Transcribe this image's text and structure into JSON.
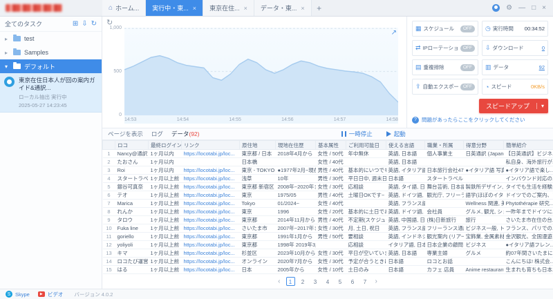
{
  "topbar": {
    "tabs": [
      {
        "label": "ホーム...",
        "icon": "⌂"
      },
      {
        "label": "実行中・東...",
        "close": "×",
        "cls": "active"
      },
      {
        "label": "東京在住...",
        "close": "×"
      },
      {
        "label": "データ・東...",
        "close": "×"
      }
    ],
    "new_tab": "+",
    "window_icons": {
      "gear": "⚙",
      "minimize": "—",
      "maximize": "□",
      "close": "×"
    }
  },
  "sidebar": {
    "title": "全てのタスク",
    "toolbar": [
      {
        "name": "new-task-icon",
        "glyph": "⊞"
      },
      {
        "name": "import-task-icon",
        "glyph": "⇩"
      },
      {
        "name": "refresh-tasks-icon",
        "glyph": "↻"
      }
    ],
    "tree": [
      {
        "arrow": "▸",
        "label": "test"
      },
      {
        "arrow": "▸",
        "label": "Samples"
      },
      {
        "arrow": "▾",
        "label": "デフォルト",
        "cls": "selected"
      }
    ],
    "task": {
      "title": "東京在住日本人が回の案内ガイド&通訳...",
      "line1": "ローカル抽出 実行中",
      "line2": "2025-05-27 14:23:45"
    }
  },
  "main_icons": {
    "refresh": "↻",
    "expand": "↗"
  },
  "chart_data": {
    "type": "area",
    "title": "",
    "ylim": [
      0,
      1000
    ],
    "y_max": 1000,
    "y_ticks": [
      "1,000",
      "500",
      "0"
    ],
    "x_ticks": [
      "14:53",
      "14:54",
      "14:55",
      "14:56",
      "14:57",
      "14:58"
    ],
    "values": [
      520,
      560,
      610,
      660,
      680,
      650,
      600,
      570,
      555,
      540,
      430,
      400,
      470,
      580,
      640,
      600,
      520,
      480,
      520,
      580,
      620,
      600,
      560,
      535,
      520,
      505,
      495,
      480,
      440,
      380,
      250,
      150
    ]
  },
  "stats": {
    "boxes": [
      {
        "name": "calendar-icon",
        "glyph": "▦",
        "label": "スケジュール",
        "badge": "OFF"
      },
      {
        "name": "clock-icon",
        "glyph": "◷",
        "label": "実行時間",
        "value": "00:34:52",
        "vcls": "v-dark"
      },
      {
        "name": "ip-rotation-icon",
        "glyph": "⇄",
        "label": "IPローテーション",
        "badge": "OFF"
      },
      {
        "name": "download-icon",
        "glyph": "⇩",
        "label": "ダウンロード",
        "value": "0",
        "vcls": "v-link"
      },
      {
        "name": "dedup-icon",
        "glyph": "▤",
        "label": "重複排除",
        "badge": "OFF"
      },
      {
        "name": "database-icon",
        "glyph": "▥",
        "label": "データ",
        "value": "92",
        "vcls": "v-link"
      },
      {
        "name": "export-icon",
        "glyph": "⇪",
        "label": "自動エクスポート",
        "badge": "OFF"
      },
      {
        "name": "speed-icon",
        "glyph": "◔",
        "label": "スピード",
        "value": "0KB/s",
        "vcls": "v-orange"
      }
    ],
    "speedup_label": "スピードアップ",
    "speedup_caret": "▾",
    "help_icon": "?",
    "help_text": "問題があったらここをクリックしてください"
  },
  "controls": {
    "tabs": [
      {
        "label": "ページを表示"
      },
      {
        "label": "ログ"
      },
      {
        "label": "データ",
        "count": "(92)",
        "cls": "active"
      }
    ],
    "pause_label": "一時停止",
    "run_label": "起動"
  },
  "table": {
    "columns": [
      "ロコ",
      "最終ログイン",
      "リンク",
      "原住地",
      "現地在住歴",
      "基本属性",
      "ご利用可能日",
      "使える言語",
      "職業・所属",
      "得意分野",
      "簡単紹介"
    ],
    "rows": [
      [
        "Nancy@通訳",
        "1ヶ月以内",
        "https://locotabi.jp/loc...",
        "東京都 / 日本",
        "2018年4月から",
        "女性 / 50代",
        "年中無休",
        "英語, 日本語",
        "個人事業主",
        "日英通訳 (Japanese...",
        "【日英通訳】ビジネ..."
      ],
      [
        "たおさん",
        "1ヶ月以内",
        "",
        "日本橋",
        "",
        "女性 / 40代",
        "",
        "英語, 日本語",
        "",
        "",
        "私自身、海外旅行が..."
      ],
      [
        "Roi",
        "1ヶ月以内",
        "https://locotabi.jp/loc...",
        "東京 - TOKYO",
        "●1977年2月~現在...",
        "男性 / 40代",
        "基本的にいつでも可",
        "英語, イタリア語, 日...",
        "日本旅行会社47年勤...",
        "●イタリア語 写真...",
        "●イタリア語で楽し..."
      ],
      [
        "スタートラベル",
        "1ヶ月以上前",
        "https://locotabi.jp/loc...",
        "浅草",
        "10年",
        "男性 / 30代",
        "平日日中, 週末日中",
        "日本語",
        "スタートラベル",
        "",
        "インバウンド対応の..."
      ],
      [
        "銀谷可真奈",
        "1ヶ月以上前",
        "https://locotabi.jp/loc...",
        "東京都 新宿区",
        "2008年~2020年ま...",
        "女性 / 30代",
        "応相談",
        "英語, タイ語, 日本語",
        "舞台芸術, 日本語教...",
        "製鉄所デザイン, 縫...",
        "タイでも生活を経験..."
      ],
      [
        "テオ",
        "1ヶ月以上前",
        "https://locotabi.jp/loc...",
        "東京",
        "1975/05",
        "男性 / 40代",
        "土曜日OKです~",
        "英語, ドイツ語, フラ...",
        "観光庁, フリーラン...",
        "語学(ほぼのイタリア...",
        "ドイツでのご案内、ア..."
      ],
      [
        "Marica",
        "1ヶ月以上前",
        "https://locotabi.jp/loc...",
        "Tokyo",
        "01/2024~",
        "女性 / 40代",
        "",
        "英語, フランス語, 日...",
        "",
        "Wellness 関連, 美...",
        "Phytothérapie 研究..."
      ],
      [
        "れんか",
        "1ヶ月以上前",
        "https://locotabi.jp/loc...",
        "東京",
        "1996",
        "女性 / 20代",
        "基本的に土日であれ...",
        "英語, ドイツ語, 日本語",
        "会社員",
        "グルメ, 観光, ショッ...",
        "一昨年までドイツに..."
      ],
      [
        "タロウ",
        "1ヶ月以上前",
        "https://locotabi.jp/loc...",
        "東京都",
        "2014年11月から",
        "男性 / 40代",
        "不定期(スケジュール...",
        "英語, 中国語, 日本語",
        "(株)日新旅行",
        "旅行",
        "さいたま市在住の台..."
      ],
      [
        "Fuka line",
        "1ヶ月以上前",
        "https://locotabi.jp/loc...",
        "さいたま市",
        "2007年~2017年ま...",
        "女性 / 30代",
        "月, 土日, 祝日",
        "英語, フランス語, 日...",
        "フリーランス通訳翻...",
        "ビジネス一般, トラベ...",
        "フランス、パリでの..."
      ],
      [
        "goriello",
        "1ヶ月以上前",
        "https://locotabi.jp/loc...",
        "東京都",
        "1991年1月から",
        "男性 / 50代",
        "要相談",
        "英語, インドネシア語",
        "観光案内 (リアーガ...",
        "宝飾業, 金属素材...",
        "金沢観光、全国漫遊..."
      ],
      [
        "yoliyoli",
        "1ヶ月以上前",
        "https://locotabi.jp/loc...",
        "東京都",
        "1998年 2019年3月...",
        "",
        "応相談",
        "イタリア語, 日本語",
        "日本企業の顧問",
        "ビジネス",
        "●イタリア語フレン..."
      ],
      [
        "キマ",
        "1ヶ月以上前",
        "https://locotabi.jp/loc...",
        "杉並区",
        "2023年10月から",
        "女性 / 30代",
        "平日が空いています...",
        "英語, 日本語",
        "専業主婦",
        "グルメ",
        "約07年間さいたまに..."
      ],
      [
        "ロコたび運営",
        "1ヶ月以上前",
        "https://locotabi.jp/loc...",
        "オンライン",
        "2020年7月から",
        "女性 / 30代",
        "予定が合うときに",
        "日本語",
        "ロコとお話",
        "",
        "こんにちは! 株式会..."
      ],
      [
        "はる",
        "1ヶ月以上前",
        "https://locotabi.jp/loc...",
        "日本",
        "2005年から",
        "女性 / 10代",
        "土日のみ",
        "日本語",
        "カフェ 店員",
        "Anime restaurant",
        "生まれも育ちも日本..."
      ]
    ]
  },
  "pagination": {
    "prev": "‹",
    "pages": [
      {
        "n": "1",
        "cls": "active"
      },
      {
        "n": "2"
      },
      {
        "n": "3"
      },
      {
        "n": "4"
      },
      {
        "n": "5"
      },
      {
        "n": "6"
      },
      {
        "n": "7"
      }
    ],
    "next": "›"
  },
  "footer": {
    "skype_label": "Skype",
    "video_label": "ビデオ",
    "version": "バージョン 4.0.2"
  }
}
